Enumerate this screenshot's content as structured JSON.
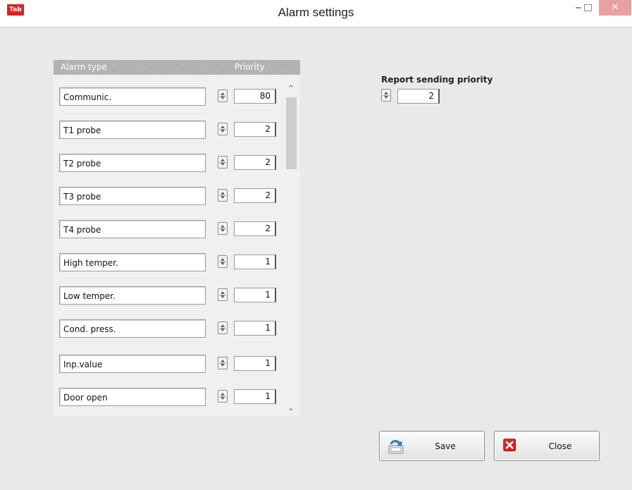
{
  "window": {
    "app_icon_label": "Tab",
    "title": "Alarm settings",
    "minimize_glyph": "‒",
    "close_glyph": "✕"
  },
  "table": {
    "col_type": "Alarm type",
    "col_priority": "Priority",
    "rows": [
      {
        "type": "Communic.",
        "priority": "80"
      },
      {
        "type": "T1 probe",
        "priority": "2"
      },
      {
        "type": "T2 probe",
        "priority": "2"
      },
      {
        "type": "T3 probe",
        "priority": "2"
      },
      {
        "type": "T4 probe",
        "priority": "2"
      },
      {
        "type": "High temper.",
        "priority": "1"
      },
      {
        "type": "Low temper.",
        "priority": "1"
      },
      {
        "type": "Cond. press.",
        "priority": "1"
      },
      {
        "type": "Inp.value",
        "priority": "1"
      },
      {
        "type": "Door open",
        "priority": "1"
      }
    ]
  },
  "scroll": {
    "up_glyph": "^",
    "down_glyph": "⌄"
  },
  "report": {
    "label": "Report sending priority",
    "value": "2"
  },
  "buttons": {
    "save_label": "Save",
    "close_label": "Close"
  },
  "colors": {
    "close_red": "#e02020",
    "header_stripe": "#b0b0b0",
    "background": "#e9e9e9"
  },
  "icons": {
    "save": "save-disk-arrow-icon",
    "close": "close-x-icon",
    "spin": "spinner-arrows-icon"
  }
}
